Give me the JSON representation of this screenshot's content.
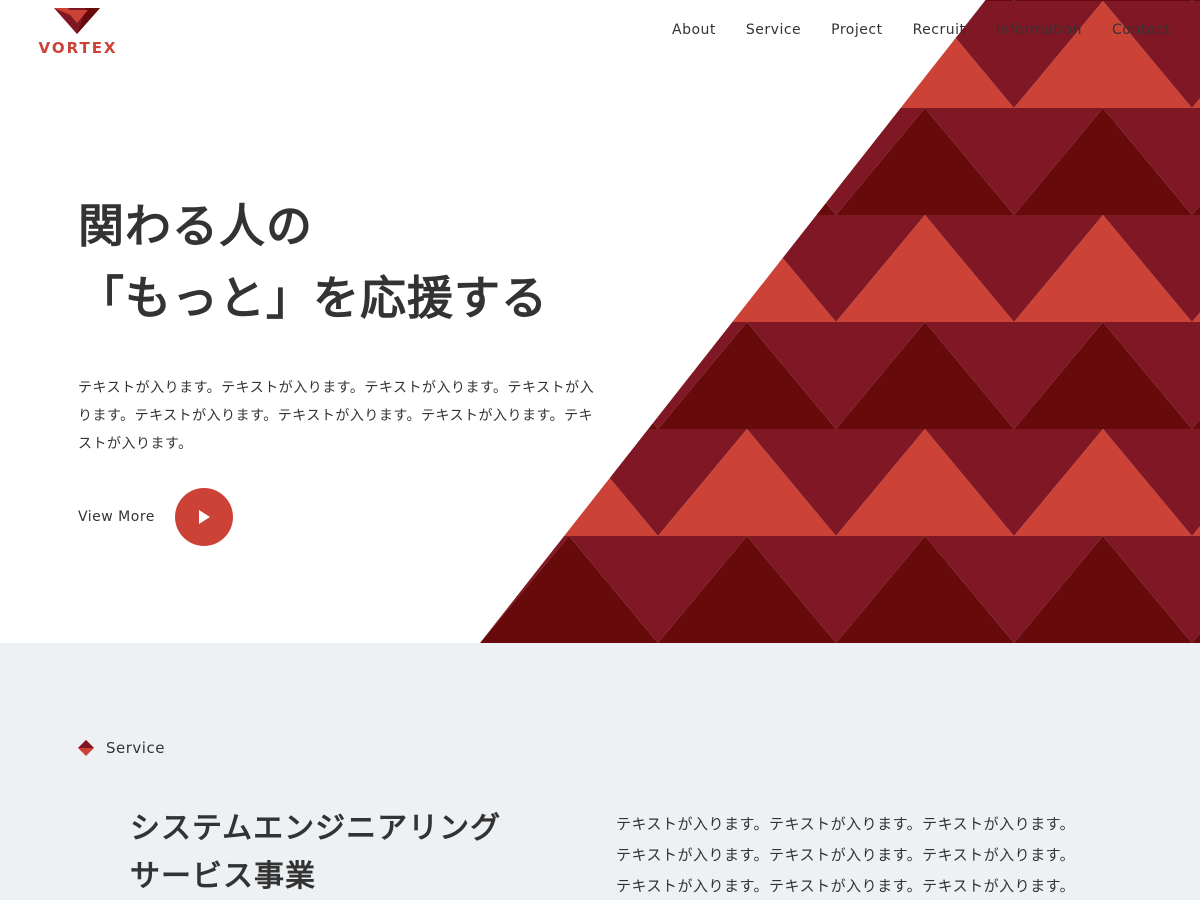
{
  "brand": {
    "name": "VORTEX",
    "colors": {
      "red": "#cc4237",
      "crimson": "#7f1824",
      "dark": "#660a0c",
      "text": "#333333"
    }
  },
  "nav": {
    "items": [
      "About",
      "Service",
      "Project",
      "Recruit",
      "Information",
      "Contact"
    ]
  },
  "hero": {
    "title_line1": "関わる人の",
    "title_line2": "「もっと」を応援する",
    "text": "テキストが入ります。テキストが入ります。テキストが入ります。テキストが入ります。テキストが入ります。テキストが入ります。テキストが入ります。テキストが入ります。",
    "cta_label": "View More",
    "cta_icon": "play-icon"
  },
  "service": {
    "label": "Service",
    "label_icon": "diamond-icon",
    "title_line1": "システムエンジニアリング",
    "title_line2": "サービス事業",
    "text": "テキストが入ります。テキストが入ります。テキストが入ります。テキストが入ります。テキストが入ります。テキストが入ります。テキストが入ります。テキストが入ります。テキストが入ります。"
  }
}
